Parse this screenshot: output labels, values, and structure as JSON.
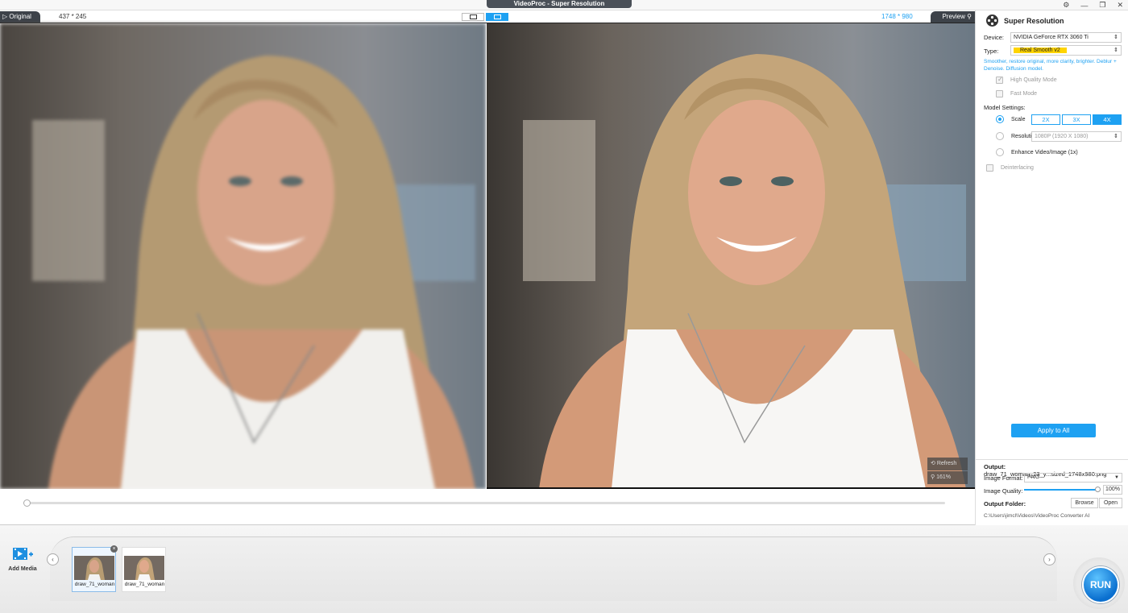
{
  "window": {
    "title": "VideoProc - Super Resolution"
  },
  "preview": {
    "original_label": "Original",
    "original_dims": "437 * 245",
    "preview_label": "Preview",
    "preview_dims": "1748 * 980",
    "refresh_label": "Refresh",
    "zoom": "161%"
  },
  "panel": {
    "title": "Super Resolution",
    "device_label": "Device:",
    "device_value": "NVIDIA GeForce RTX 3060 Ti",
    "type_label": "Type:",
    "type_value": "Real Smooth v2",
    "type_desc": "Smoother, restore original, more clarity, brighter. Deblur + Denoise. Diffusion model.",
    "high_quality_label": "High Quality Mode",
    "fast_mode_label": "Fast Mode",
    "model_settings_label": "Model Settings:",
    "scale_label": "Scale",
    "scale_options": [
      "2X",
      "3X",
      "4X"
    ],
    "resolution_label": "Resolution",
    "resolution_value": "1080P (1920 X 1080)",
    "enhance_label": "Enhance Video/Image (1x)",
    "deinterlacing_label": "Deinterlacing",
    "apply_all_label": "Apply to All",
    "output_label": "Output:",
    "output_file": "draw_71_woman_23_y...sized_1748x980.png",
    "format_label": "Image Format:",
    "format_value": "PNG",
    "quality_label": "Image Quality:",
    "quality_value": "100%",
    "folder_label": "Output Folder:",
    "browse_label": "Browse",
    "open_label": "Open",
    "folder_path": "C:\\Users\\jimcl\\Videos\\VideoProc Converter AI"
  },
  "media": {
    "add_media_label": "Add Media",
    "thumbs": [
      {
        "label": "draw_71_woman"
      },
      {
        "label": "draw_71_woman"
      }
    ],
    "run_label": "RUN"
  },
  "colors": {
    "accent": "#1ea1f2",
    "dark_tab": "#3d4249",
    "highlight": "#ffd400"
  }
}
